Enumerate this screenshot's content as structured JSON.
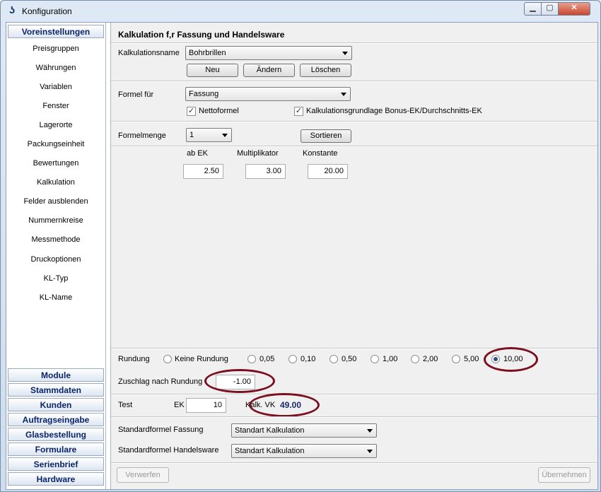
{
  "window": {
    "title": "Konfiguration",
    "min_glyph": "▁",
    "max_glyph": "▢",
    "close_glyph": "✕"
  },
  "sidebar": {
    "active_group": "Voreinstellungen",
    "items": [
      "Preisgruppen",
      "Währungen",
      "Variablen",
      "Fenster",
      "Lagerorte",
      "Packungseinheit",
      "Bewertungen",
      "Kalkulation",
      "Felder ausblenden",
      "Nummernkreise",
      "Messmethode",
      "Druckoptionen",
      "KL-Typ",
      "KL-Name"
    ],
    "groups": [
      "Module",
      "Stammdaten",
      "Kunden",
      "Auftragseingabe",
      "Glasbestellung",
      "Formulare",
      "Serienbrief",
      "Hardware"
    ]
  },
  "main": {
    "title": "Kalkulation f‚r Fassung und Handelsware",
    "kalk_name": {
      "label": "Kalkulationsname",
      "value": "Bohrbrillen"
    },
    "buttons": {
      "neu": "Neu",
      "aendern": "Ändern",
      "loeschen": "Löschen"
    },
    "formel": {
      "label": "Formel für",
      "value": "Fassung"
    },
    "checks": {
      "netto": "Nettoformel",
      "bonus": "Kalkulationsgrundlage Bonus-EK/Durchschnitts-EK",
      "check_glyph": "✓"
    },
    "formelmenge": {
      "label": "Formelmenge",
      "value": "1"
    },
    "sortieren": "Sortieren",
    "columns": {
      "ab_ek": "ab EK",
      "multiplikator": "Multiplikator",
      "konstante": "Konstante"
    },
    "values": {
      "ab_ek": "2.50",
      "multiplikator": "3.00",
      "konstante": "20.00"
    },
    "rundung": {
      "label": "Rundung",
      "options": [
        "Keine Rundung",
        "0,05",
        "0,10",
        "0,50",
        "1,00",
        "2,00",
        "5,00",
        "10,00"
      ],
      "selected": "10,00"
    },
    "zuschlag": {
      "label": "Zuschlag nach Rundung",
      "value": "-1.00"
    },
    "test": {
      "label": "Test",
      "ek_label": "EK",
      "ek_value": "10",
      "vk_label": "Kalk. VK",
      "vk_value": "49.00"
    },
    "std_fassung": {
      "label": "Standardformel Fassung",
      "value": "Standart Kalkulation"
    },
    "std_handelsware": {
      "label": "Standardformel Handelsware",
      "value": "Standart Kalkulation"
    },
    "footer": {
      "verwerfen": "Verwerfen",
      "uebernehmen": "Übernehmen"
    }
  }
}
